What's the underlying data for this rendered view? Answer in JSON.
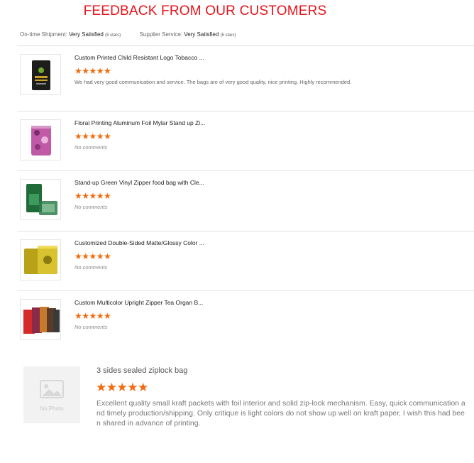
{
  "header": {
    "title": "FEEDBACK FROM OUR CUSTOMERS"
  },
  "ratings": {
    "shipment_label": "On-time Shipment:",
    "shipment_value": "Very Satisfied",
    "shipment_stars": "(5 stars)",
    "service_label": "Supplier Service:",
    "service_value": "Very Satisfied",
    "service_stars": "(5 stars)"
  },
  "reviews": [
    {
      "name": "Custom Printed Child Resistant Logo Tobacco ...",
      "stars": "★★★★★",
      "rating": 5,
      "comment": "We had very good communication and service. The bags are of very good quality, nice printing.  Highly recommended.",
      "no_comment": ""
    },
    {
      "name": "Floral Printing Aluminum Foil Mylar Stand up Zi...",
      "stars": "★★★★★",
      "rating": 5,
      "comment": "",
      "no_comment": "No comments"
    },
    {
      "name": "Stand-up Green Vinyl Zipper food bag with Cle...",
      "stars": "★★★★★",
      "rating": 5,
      "comment": "",
      "no_comment": "No comments"
    },
    {
      "name": "Customized Double-Sided Matte/Glossy Color ...",
      "stars": "★★★★★",
      "rating": 5,
      "comment": "",
      "no_comment": "No comments"
    },
    {
      "name": "Custom Multicolor Upright Zipper Tea Organ B...",
      "stars": "★★★★★",
      "rating": 5,
      "comment": "",
      "no_comment": "No comments"
    }
  ],
  "featured": {
    "photo_placeholder": "No Photo",
    "name": "3 sides sealed ziplock bag",
    "stars": "★★★★★",
    "rating": 5,
    "comment": "Excellent quality small kraft packets with foil interior and solid zip-lock mechanism. Easy, quick communication and timely production/shipping. Only critique is light colors do not show up well on kraft paper, I wish this had been shared in advance of printing."
  },
  "colors": {
    "title": "#e8131b",
    "star": "#f26b0f",
    "divider": "#e2e2e2"
  }
}
